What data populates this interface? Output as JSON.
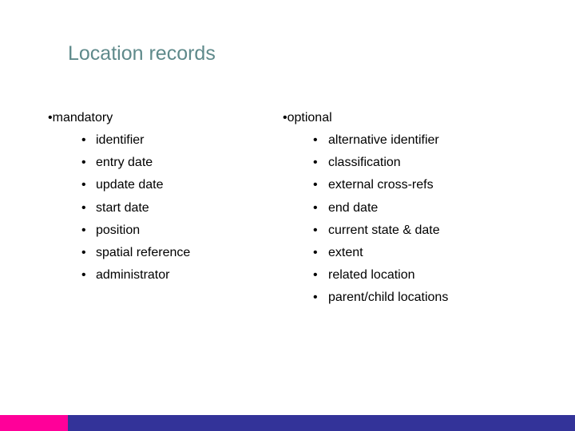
{
  "slide": {
    "title": "Location records",
    "bullet_glyph": "•",
    "columns": [
      {
        "heading": "mandatory",
        "items": [
          "identifier",
          "entry date",
          "update date",
          "start date",
          "position",
          "spatial reference",
          "administrator"
        ]
      },
      {
        "heading": "optional",
        "items": [
          "alternative identifier",
          "classification",
          "external cross-refs",
          "end date",
          "current state & date",
          "extent",
          "related location",
          "parent/child locations"
        ]
      }
    ],
    "colors": {
      "title": "#5f8a8b",
      "bar": "#333399",
      "bar_accent": "#ff0099"
    }
  }
}
